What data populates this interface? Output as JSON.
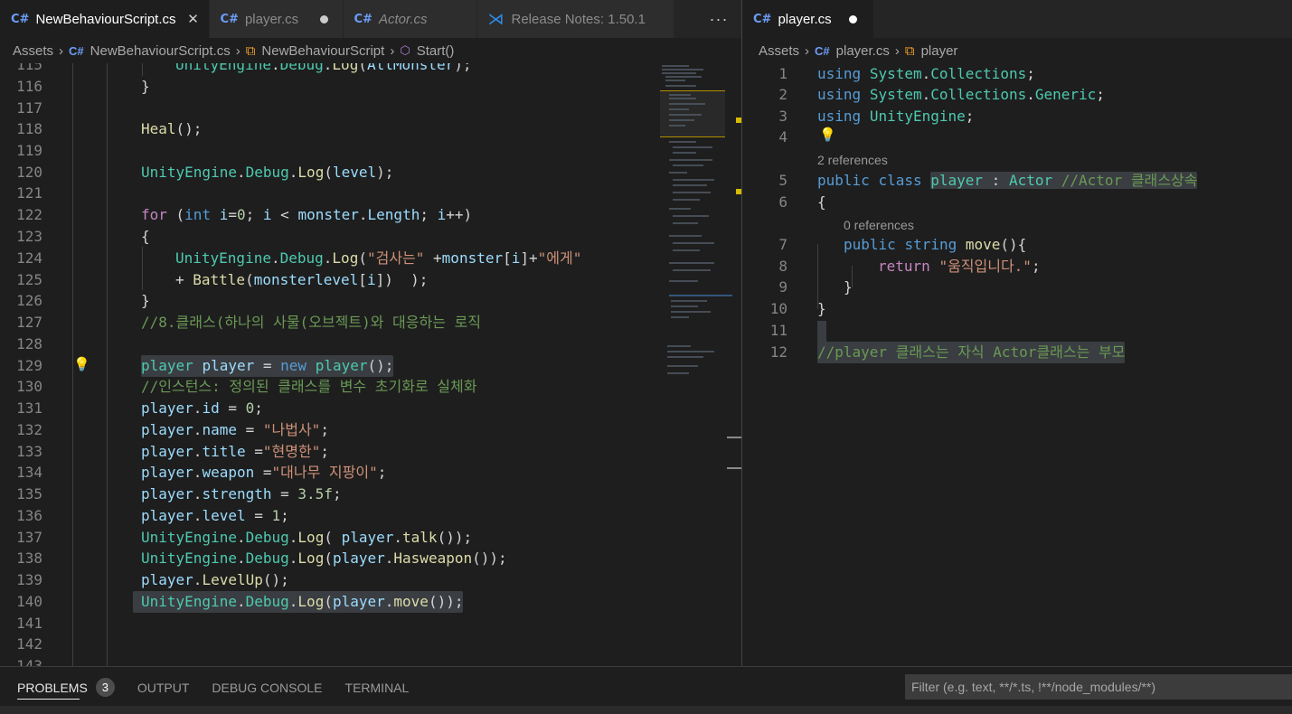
{
  "left": {
    "tabs": [
      {
        "label": "NewBehaviourScript.cs",
        "icon": "csharp-icon",
        "state": "close",
        "active": true,
        "italic": false
      },
      {
        "label": "player.cs",
        "icon": "csharp-icon",
        "state": "dirty",
        "active": false,
        "italic": false
      },
      {
        "label": "Actor.cs",
        "icon": "csharp-icon",
        "state": "none",
        "active": false,
        "italic": true
      },
      {
        "label": "Release Notes: 1.50.1",
        "icon": "vscode-icon",
        "state": "none",
        "active": false,
        "italic": false
      }
    ],
    "more_label": "···",
    "breadcrumb": [
      "Assets",
      "NewBehaviourScript.cs",
      "NewBehaviourScript",
      "Start()"
    ],
    "first_line_partial": "        UnityEngine.Debug.Log(AllMonster);",
    "line_numbers": [
      "115",
      "116",
      "117",
      "118",
      "119",
      "120",
      "121",
      "122",
      "123",
      "124",
      "125",
      "126",
      "127",
      "128",
      "129",
      "130",
      "131",
      "132",
      "133",
      "134",
      "135",
      "136",
      "137",
      "138",
      "139",
      "140",
      "141",
      "142",
      "143"
    ]
  },
  "right": {
    "tabs": [
      {
        "label": "player.cs",
        "icon": "csharp-icon",
        "state": "dirty",
        "active": true
      }
    ],
    "breadcrumb": [
      "Assets",
      "player.cs",
      "player"
    ],
    "lens_class": "2 references",
    "lens_method": "0 references",
    "line_numbers": [
      "1",
      "2",
      "3",
      "4",
      "5",
      "6",
      "7",
      "8",
      "9",
      "10",
      "11",
      "12"
    ]
  },
  "panel": {
    "tabs": [
      "PROBLEMS",
      "OUTPUT",
      "DEBUG CONSOLE",
      "TERMINAL"
    ],
    "problems_count": "3",
    "filter_placeholder": "Filter (e.g. text, **/*.ts, !**/node_modules/**)"
  }
}
